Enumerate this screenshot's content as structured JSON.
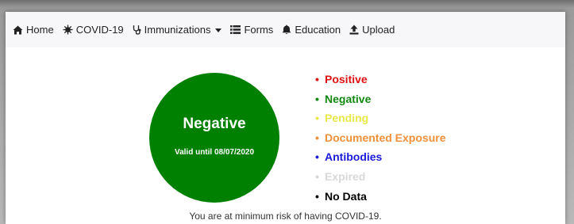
{
  "nav": {
    "home": "Home",
    "covid": "COVID-19",
    "immunizations": "Immunizations",
    "forms": "Forms",
    "education": "Education",
    "upload": "Upload"
  },
  "status": {
    "result": "Negative",
    "valid": "Valid until 08/07/2020",
    "color": "#008000"
  },
  "legend": [
    {
      "label": "Positive",
      "color": "#dd1111"
    },
    {
      "label": "Negative",
      "color": "#118811"
    },
    {
      "label": "Pending",
      "color": "#e8e84a"
    },
    {
      "label": "Documented Exposure",
      "color": "#f0903a"
    },
    {
      "label": "Antibodies",
      "color": "#1a1ad8"
    },
    {
      "label": "Expired",
      "color": "#d8d8d8"
    },
    {
      "label": "No Data",
      "color": "#000000"
    }
  ],
  "message": "You are at minimum risk of having COVID-19.",
  "icons": {
    "home": "home-icon",
    "covid": "virus-icon",
    "immunizations": "stethoscope-icon",
    "forms": "list-icon",
    "education": "bell-icon",
    "upload": "upload-icon"
  }
}
